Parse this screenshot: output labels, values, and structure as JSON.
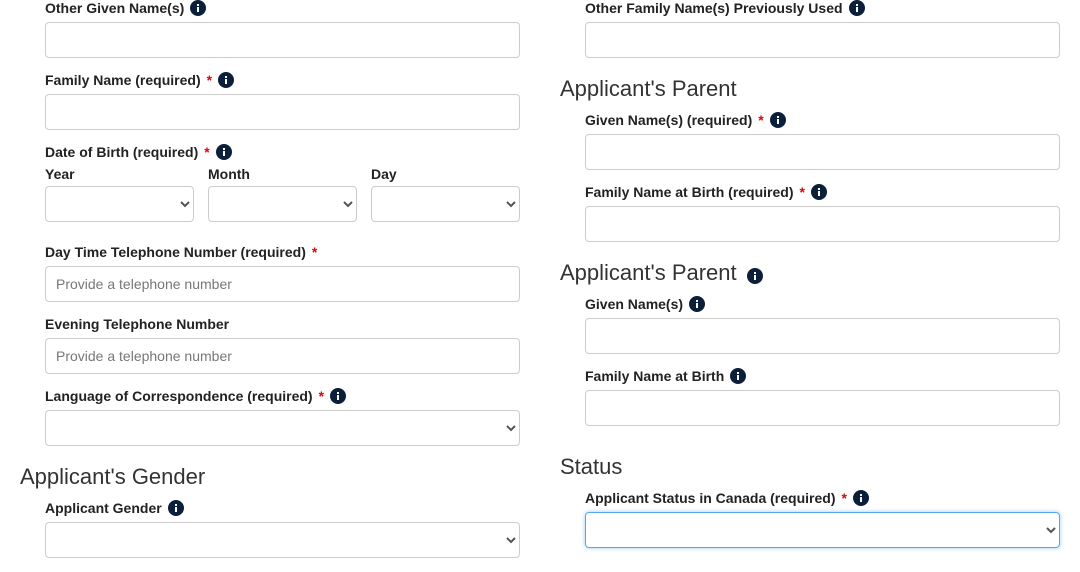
{
  "left": {
    "other_given_names_label": "Other Given Name(s)",
    "family_name_label": "Family Name (required)",
    "dob_label": "Date of Birth (required)",
    "year_label": "Year",
    "month_label": "Month",
    "day_label": "Day",
    "day_phone_label": "Day Time Telephone Number (required)",
    "phone_placeholder": "Provide a telephone number",
    "evening_phone_label": "Evening Telephone Number",
    "language_label": "Language of Correspondence (required)",
    "gender_section": "Applicant's Gender",
    "gender_label": "Applicant Gender"
  },
  "right": {
    "other_family_names_label": "Other Family Name(s) Previously Used",
    "parent1_section": "Applicant's Parent",
    "parent1_given_label": "Given Name(s) (required)",
    "parent1_family_label": "Family Name at Birth (required)",
    "parent2_section": "Applicant's Parent",
    "parent2_given_label": "Given Name(s)",
    "parent2_family_label": "Family Name at Birth",
    "status_section": "Status",
    "status_label": "Applicant Status in Canada (required)"
  }
}
